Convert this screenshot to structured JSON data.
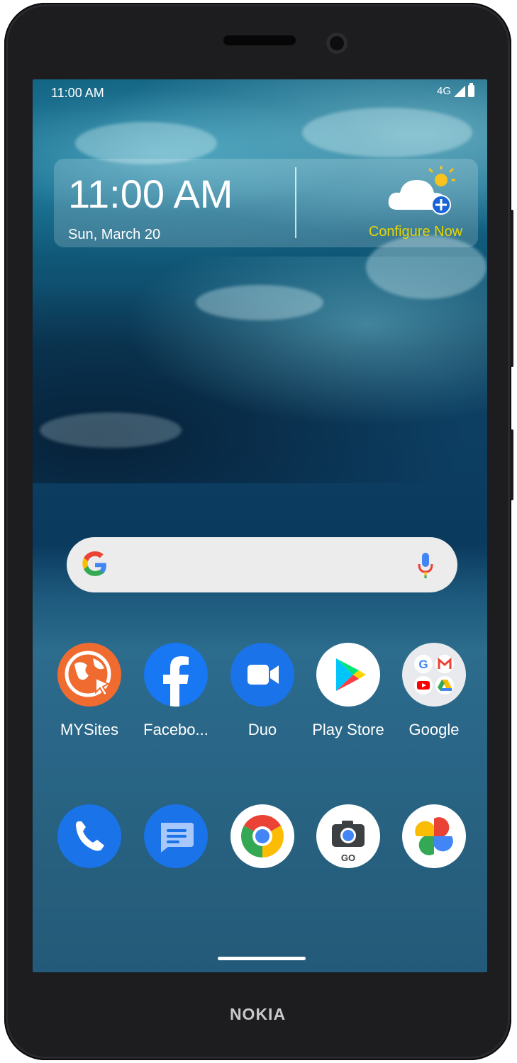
{
  "device": {
    "brand": "NOKIA"
  },
  "status_bar": {
    "time": "11:00 AM",
    "network": "4G"
  },
  "clock_widget": {
    "time": "11:00 AM",
    "date": "Sun, March 20"
  },
  "weather_widget": {
    "label": "Configure Now",
    "icon": "cloud-sun-plus-icon"
  },
  "search": {
    "logo": "google-g-icon",
    "mic": "mic-icon"
  },
  "apps_row_1": [
    {
      "label": "MYSites",
      "icon": "globe-cursor-icon",
      "color": "#ef6b30"
    },
    {
      "label": "Facebo...",
      "icon": "facebook-icon",
      "color": "#1877f2"
    },
    {
      "label": "Duo",
      "icon": "video-camera-icon",
      "color": "#1a73e8"
    },
    {
      "label": "Play Store",
      "icon": "play-store-icon",
      "color": "#ffffff"
    },
    {
      "label": "Google",
      "icon": "google-folder-icon",
      "color": "#e8eaed"
    }
  ],
  "dock": [
    {
      "icon": "phone-icon",
      "color": "#1a73e8"
    },
    {
      "icon": "messages-icon",
      "color": "#1a73e8"
    },
    {
      "icon": "chrome-icon",
      "color": "#ffffff"
    },
    {
      "icon": "camera-go-icon",
      "color": "#ffffff",
      "badge": "GO"
    },
    {
      "icon": "photos-icon",
      "color": "#ffffff"
    }
  ],
  "colors": {
    "accent_yellow": "#e6d600",
    "search_bg": "#ececec"
  }
}
